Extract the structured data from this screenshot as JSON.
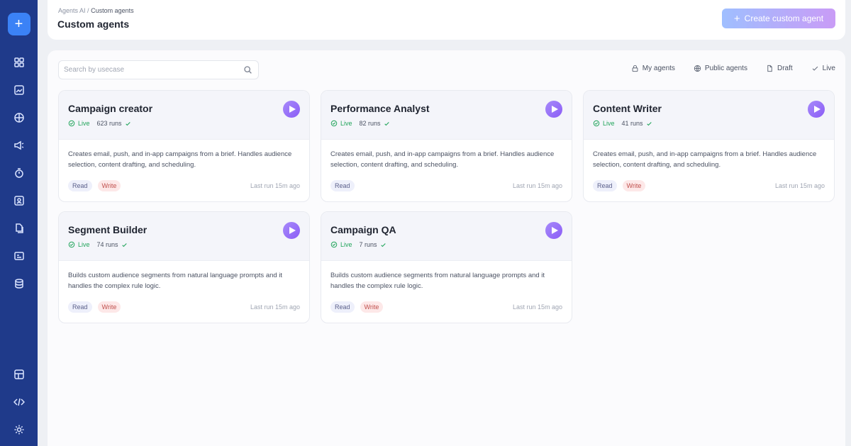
{
  "sidebar": {
    "new_button": "+",
    "top_icons": [
      "dashboard-icon",
      "image-icon",
      "globe-icon",
      "megaphone-icon",
      "timer-icon",
      "user-frame-icon",
      "files-icon",
      "id-card-icon",
      "database-icon"
    ],
    "bottom_icons": [
      "layout-icon",
      "code-icon",
      "settings-icon"
    ]
  },
  "header": {
    "breadcrumb_parent": "Agents AI",
    "breadcrumb_sep": "/",
    "breadcrumb_current": "Custom agents",
    "title": "Custom agents",
    "create_button": "Create custom agent"
  },
  "search": {
    "placeholder": "Search by usecase",
    "value": ""
  },
  "filters": [
    {
      "label": "My agents",
      "icon": "lock-icon"
    },
    {
      "label": "Public agents",
      "icon": "globe-icon"
    },
    {
      "label": "Draft",
      "icon": "document-icon"
    },
    {
      "label": "Live",
      "icon": "check-icon"
    }
  ],
  "agents": [
    {
      "name": "Campaign creator",
      "status": "Live",
      "runs": "623 runs",
      "description": "Creates email, push, and in-app campaigns from a brief. Handles audience selection, content drafting, and scheduling.",
      "tags": [
        "Read",
        "Write"
      ],
      "last_run": "Last run 15m ago"
    },
    {
      "name": "Performance Analyst",
      "status": "Live",
      "runs": "82 runs",
      "description": "Creates email, push, and in-app campaigns from a brief. Handles audience selection, content drafting, and scheduling.",
      "tags": [
        "Read"
      ],
      "last_run": "Last run 15m ago"
    },
    {
      "name": "Content Writer",
      "status": "Live",
      "runs": "41 runs",
      "description": "Creates email, push, and in-app campaigns from a brief. Handles audience selection, content drafting, and scheduling.",
      "tags": [
        "Read",
        "Write"
      ],
      "last_run": "Last run 15m ago"
    },
    {
      "name": "Segment Builder",
      "status": "Live",
      "runs": "74 runs",
      "description": "Builds custom audience segments from natural language prompts and it handles the complex rule logic.",
      "tags": [
        "Read",
        "Write"
      ],
      "last_run": "Last run 15m ago"
    },
    {
      "name": "Campaign QA",
      "status": "Live",
      "runs": "7 runs",
      "description": "Builds custom audience segments from natural language prompts and it handles the complex rule logic.",
      "tags": [
        "Read",
        "Write"
      ],
      "last_run": "Last run 15m ago"
    }
  ],
  "colors": {
    "sidebar": "#1f3a8a",
    "accent": "#3b82f6",
    "live": "#22a55b",
    "play": "#8b5cf6"
  }
}
